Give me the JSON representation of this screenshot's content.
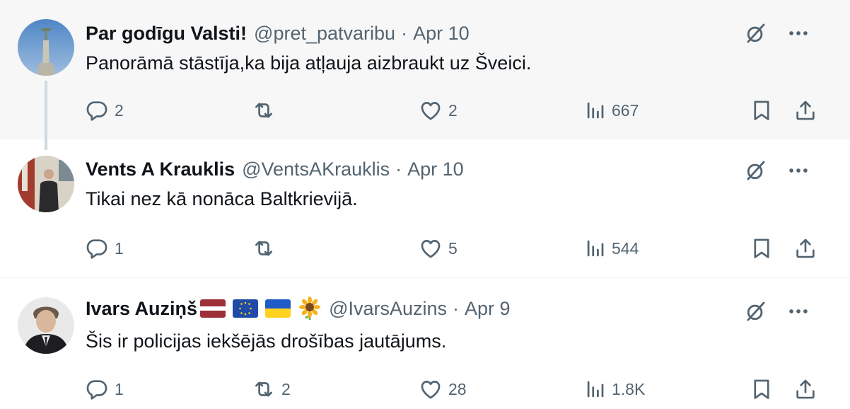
{
  "tweets": [
    {
      "name": "Par godīgu Valsti!",
      "handle": "@pret_patvaribu",
      "separator": "·",
      "date": "Apr 10",
      "text": "Panorāmā stāstīja,ka bija atļauja aizbraukt uz Šveici.",
      "replies": "2",
      "retweets": "",
      "likes": "2",
      "views": "667"
    },
    {
      "name": "Vents A Krauklis",
      "handle": "@VentsAKrauklis",
      "separator": "·",
      "date": "Apr 10",
      "text": "Tikai nez kā nonāca Baltkrievijā.",
      "replies": "1",
      "retweets": "",
      "likes": "5",
      "views": "544"
    },
    {
      "name": "Ivars Auziņš",
      "handle": "@IvarsAuzins",
      "separator": "·",
      "date": "Apr 9",
      "text": "Šis ir policijas iekšējās drošības jautājums.",
      "replies": "1",
      "retweets": "2",
      "likes": "28",
      "views": "1.8K",
      "name_emojis": [
        "latvia-flag",
        "eu-flag",
        "ukraine-flag",
        "sunflower"
      ]
    }
  ],
  "colors": {
    "text_primary": "#0f1419",
    "text_secondary": "#536471",
    "highlight_bg": "#f7f7f7",
    "thread_line": "#cfd9de"
  }
}
